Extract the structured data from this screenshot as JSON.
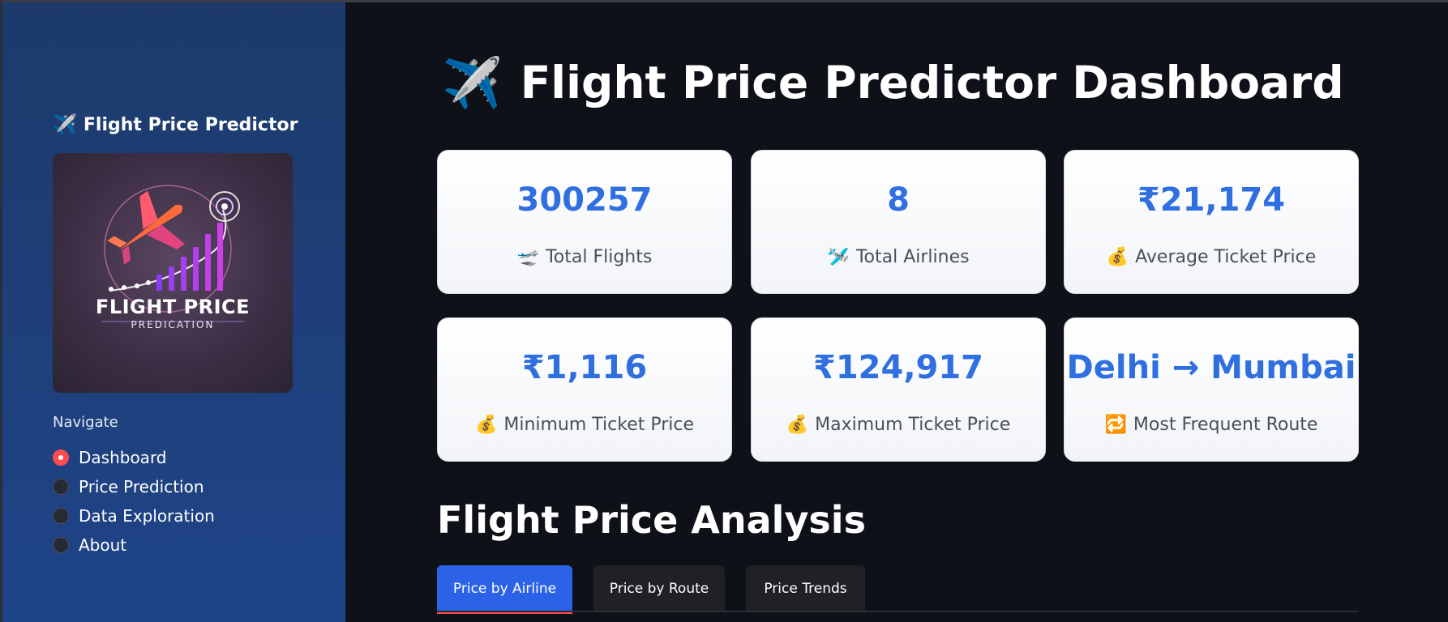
{
  "sidebar": {
    "title_icon": "✈️",
    "title": "Flight Price Predictor",
    "logo": {
      "line1": "FLIGHT PRICE",
      "line2": "PREDICATION"
    },
    "nav_label": "Navigate",
    "items": [
      {
        "label": "Dashboard",
        "selected": true
      },
      {
        "label": "Price Prediction",
        "selected": false
      },
      {
        "label": "Data Exploration",
        "selected": false
      },
      {
        "label": "About",
        "selected": false
      }
    ]
  },
  "header": {
    "title_icon": "✈️",
    "title": "Flight Price Predictor Dashboard"
  },
  "metrics": [
    {
      "value": "300257",
      "icon": "🛫",
      "label": "Total Flights"
    },
    {
      "value": "8",
      "icon": "🛩️",
      "label": "Total Airlines"
    },
    {
      "value": "₹21,174",
      "icon": "💰",
      "label": "Average Ticket Price"
    },
    {
      "value": "₹1,116",
      "icon": "💰",
      "label": "Minimum Ticket Price"
    },
    {
      "value": "₹124,917",
      "icon": "💰",
      "label": "Maximum Ticket Price"
    },
    {
      "value": "Delhi → Mumbai",
      "icon": "🔁",
      "label": "Most Frequent Route"
    }
  ],
  "analysis": {
    "title": "Flight Price Analysis",
    "tabs": [
      {
        "label": "Price by Airline",
        "active": true
      },
      {
        "label": "Price by Route",
        "active": false
      },
      {
        "label": "Price Trends",
        "active": false
      }
    ]
  },
  "colors": {
    "accent": "#2f6fe0",
    "radio_on": "#ff4b4b",
    "tab_active": "#2b62e8",
    "background": "#0e1117"
  }
}
